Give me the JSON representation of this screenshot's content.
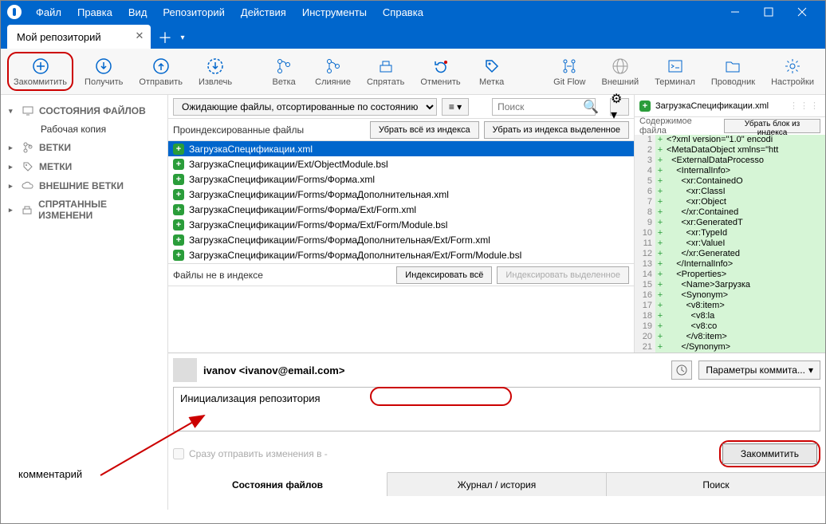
{
  "menu": [
    "Файл",
    "Правка",
    "Вид",
    "Репозиторий",
    "Действия",
    "Инструменты",
    "Справка"
  ],
  "tab": {
    "title": "Мой репозиторий"
  },
  "toolbar": [
    {
      "id": "commit",
      "label": "Закоммитить",
      "highlight": true
    },
    {
      "id": "pull",
      "label": "Получить"
    },
    {
      "id": "push",
      "label": "Отправить"
    },
    {
      "id": "fetch",
      "label": "Извлечь"
    },
    {
      "id": "branch",
      "label": "Ветка"
    },
    {
      "id": "merge",
      "label": "Слияние"
    },
    {
      "id": "stash",
      "label": "Спрятать"
    },
    {
      "id": "discard",
      "label": "Отменить"
    },
    {
      "id": "tag",
      "label": "Метка"
    },
    {
      "id": "gitflow",
      "label": "Git Flow"
    },
    {
      "id": "remote",
      "label": "Внешний",
      "disabled": true
    },
    {
      "id": "terminal",
      "label": "Терминал"
    },
    {
      "id": "explorer",
      "label": "Проводник"
    },
    {
      "id": "settings",
      "label": "Настройки"
    }
  ],
  "sidebar": {
    "file_states": "СОСТОЯНИЯ ФАЙЛОВ",
    "working_copy": "Рабочая копия",
    "branches": "ВЕТКИ",
    "tags": "МЕТКИ",
    "remotes": "ВНЕШНИЕ ВЕТКИ",
    "stashes": "СПРЯТАННЫЕ ИЗМЕНЕНИ"
  },
  "filter": {
    "pending": "Ожидающие файлы, отсортированные по состоянию",
    "search_placeholder": "Поиск"
  },
  "staged": {
    "label": "Проиндексированные файлы",
    "unstage_all": "Убрать всё из индекса",
    "unstage_selected": "Убрать из индекса выделенное",
    "files": [
      "ЗагрузкаСпецификации.xml",
      "ЗагрузкаСпецификации/Ext/ObjectModule.bsl",
      "ЗагрузкаСпецификации/Forms/Форма.xml",
      "ЗагрузкаСпецификации/Forms/ФормаДополнительная.xml",
      "ЗагрузкаСпецификации/Forms/Форма/Ext/Form.xml",
      "ЗагрузкаСпецификации/Forms/Форма/Ext/Form/Module.bsl",
      "ЗагрузкаСпецификации/Forms/ФормаДополнительная/Ext/Form.xml",
      "ЗагрузкаСпецификации/Forms/ФормаДополнительная/Ext/Form/Module.bsl"
    ]
  },
  "unstaged": {
    "label": "Файлы не в индексе",
    "stage_all": "Индексировать всё",
    "stage_selected": "Индексировать выделенное"
  },
  "diff": {
    "filename": "ЗагрузкаСпецификации.xml",
    "hunk_label": "Содержимое файла",
    "hunk_btn": "Убрать блок из индекса",
    "lines": [
      {
        "n": 1,
        "c": "<?xml version=\"1.0\" encodi"
      },
      {
        "n": 2,
        "c": "<MetaDataObject xmlns=\"htt"
      },
      {
        "n": 3,
        "c": "  <ExternalDataProcesso"
      },
      {
        "n": 4,
        "c": "    <InternalInfo>"
      },
      {
        "n": 5,
        "c": "      <xr:ContainedO"
      },
      {
        "n": 6,
        "c": "        <xr:ClassI"
      },
      {
        "n": 7,
        "c": "        <xr:Object"
      },
      {
        "n": 8,
        "c": "      </xr:Contained"
      },
      {
        "n": 9,
        "c": "      <xr:GeneratedT"
      },
      {
        "n": 10,
        "c": "        <xr:TypeId"
      },
      {
        "n": 11,
        "c": "        <xr:ValueI"
      },
      {
        "n": 12,
        "c": "      </xr:Generated"
      },
      {
        "n": 13,
        "c": "    </InternalInfo>"
      },
      {
        "n": 14,
        "c": "    <Properties>"
      },
      {
        "n": 15,
        "c": "      <Name>Загрузка"
      },
      {
        "n": 16,
        "c": "      <Synonym>"
      },
      {
        "n": 17,
        "c": "        <v8:item>"
      },
      {
        "n": 18,
        "c": "          <v8:la"
      },
      {
        "n": 19,
        "c": "          <v8:co"
      },
      {
        "n": 20,
        "c": "        </v8:item>"
      },
      {
        "n": 21,
        "c": "      </Synonym>"
      }
    ]
  },
  "commit": {
    "author": "ivanov <ivanov@email.com>",
    "message": "Инициализация репозитория",
    "push_after": "Сразу отправить изменения в -",
    "options": "Параметры коммита...",
    "button": "Закоммитить"
  },
  "bottom_tabs": {
    "file_states": "Состояния файлов",
    "log": "Журнал / история",
    "search": "Поиск"
  },
  "annotation": "комментарий"
}
